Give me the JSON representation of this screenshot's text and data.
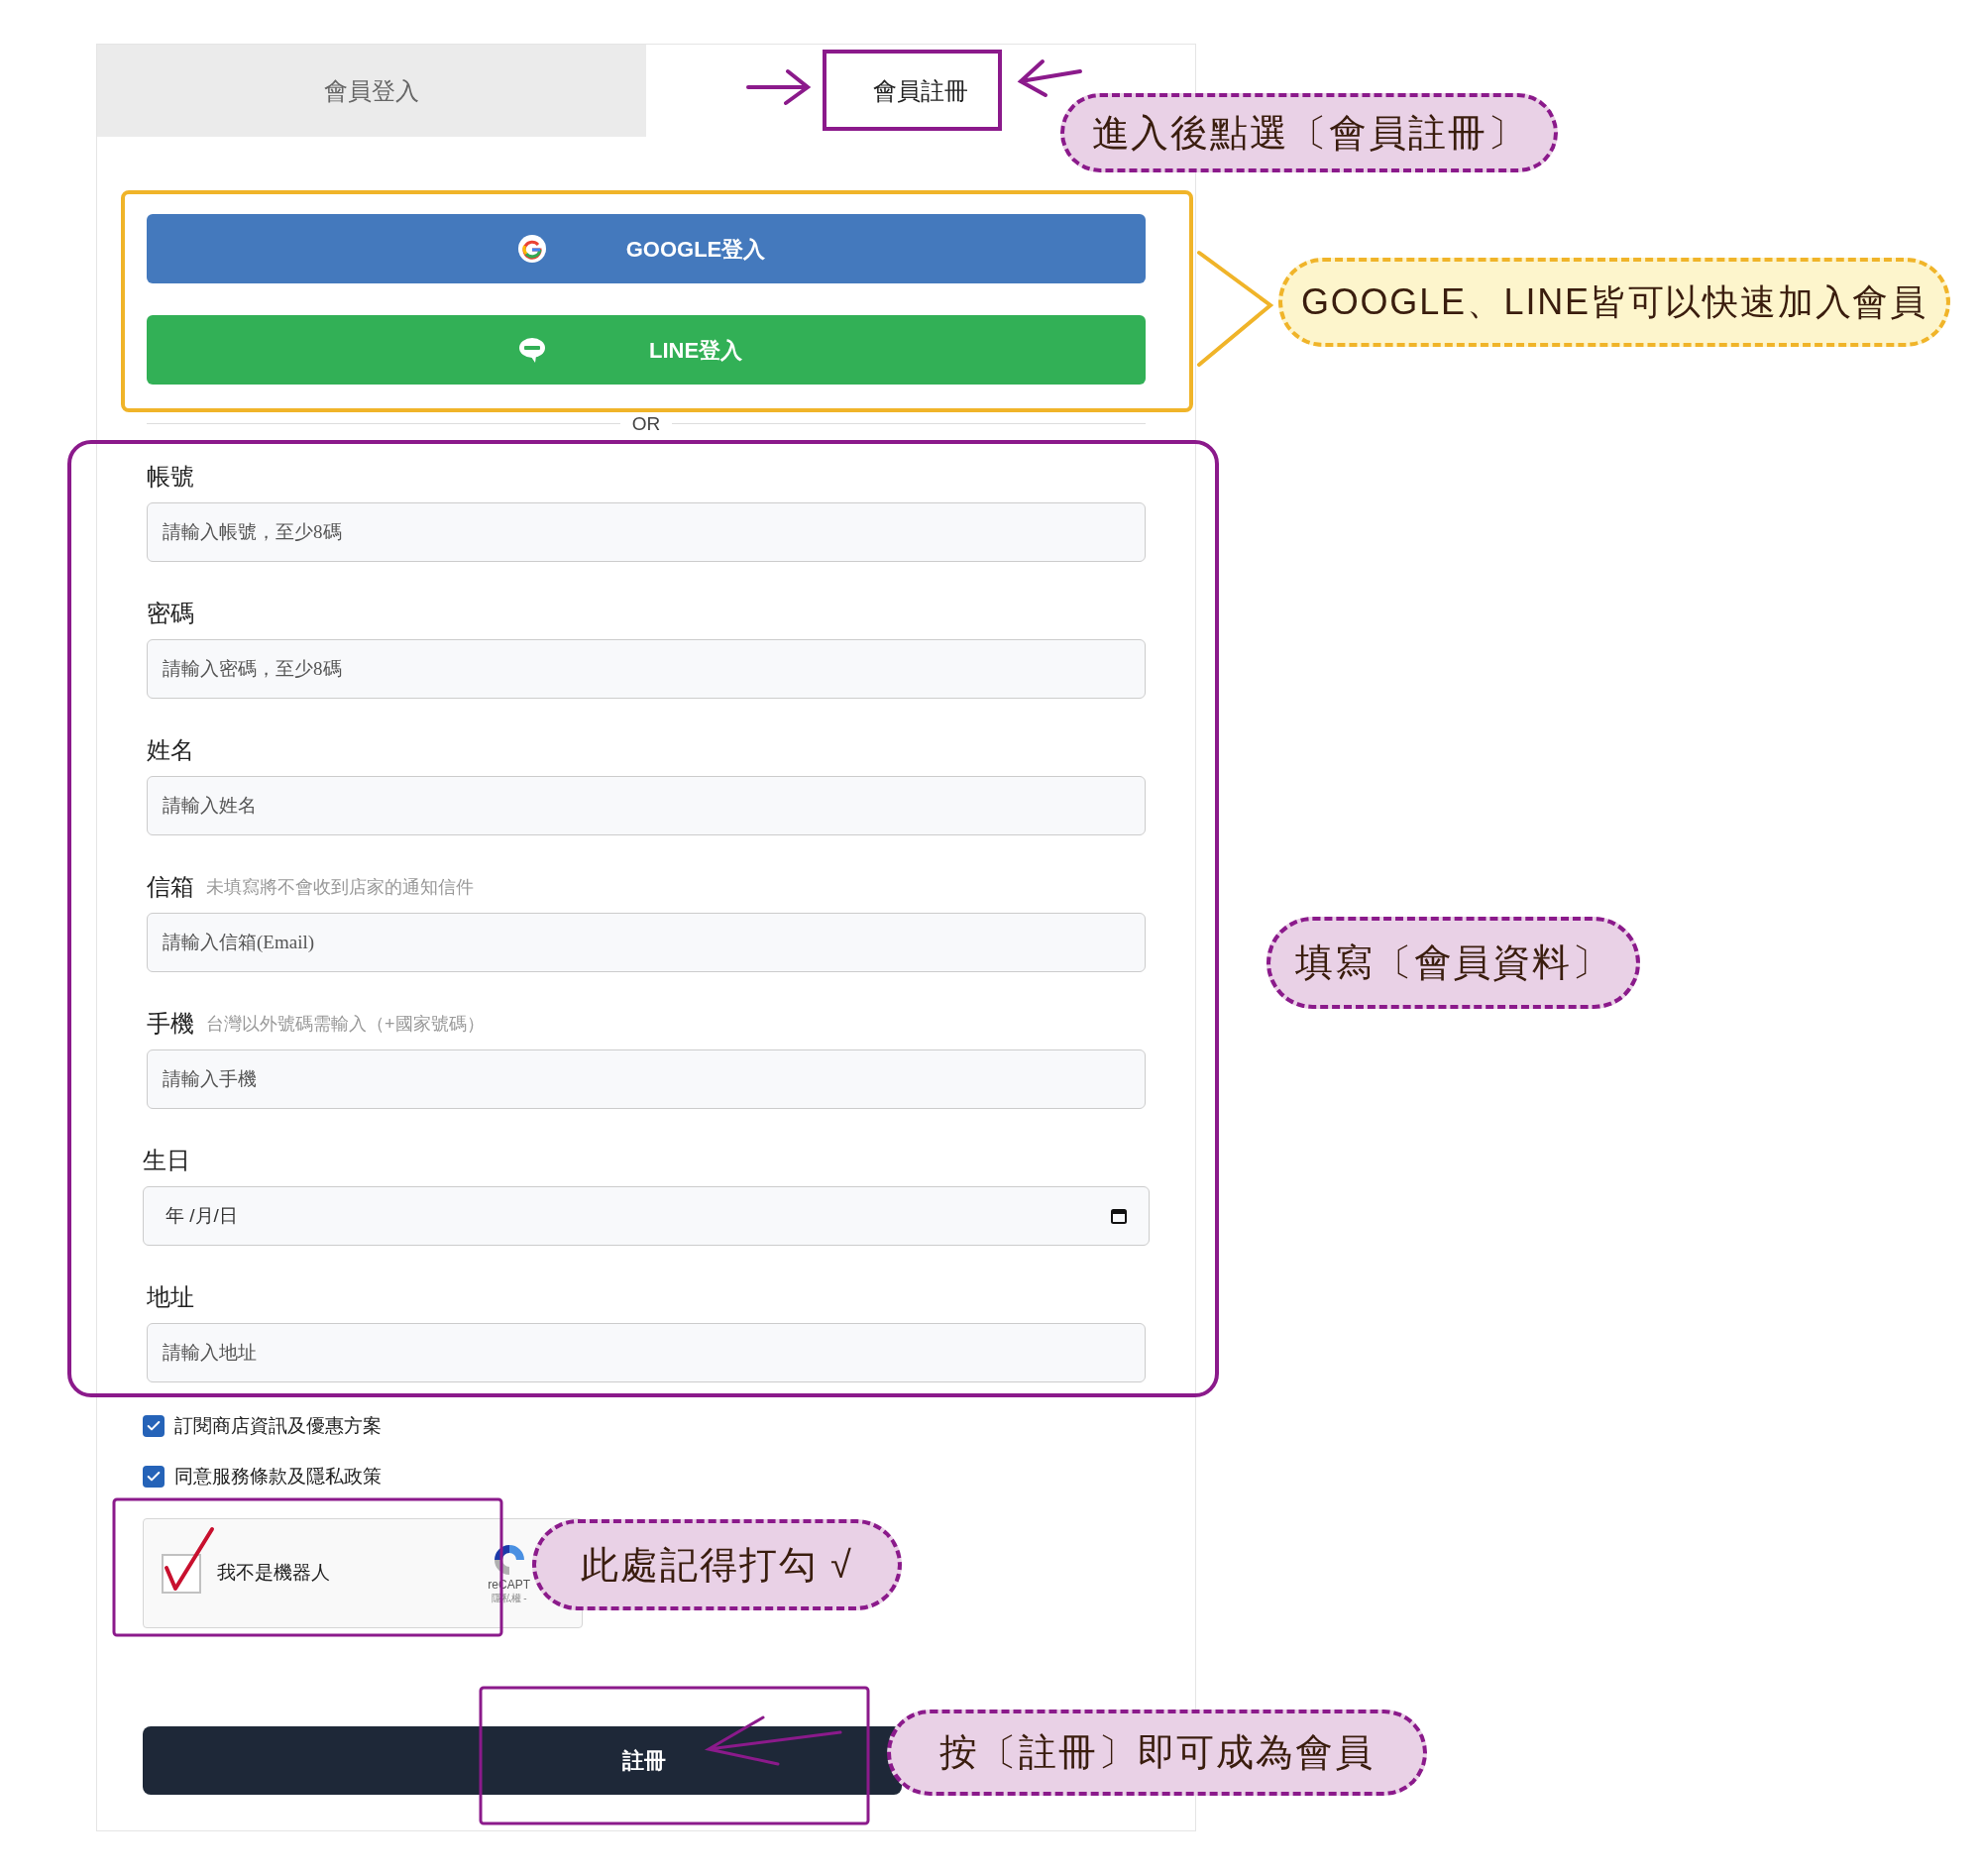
{
  "tabs": [
    {
      "label": "會員登入",
      "selected": false
    },
    {
      "label": "會員註冊",
      "selected": true
    }
  ],
  "social_buttons": [
    {
      "kind": "google",
      "label": "GOOGLE登入"
    },
    {
      "kind": "line",
      "label": "LINE登入"
    }
  ],
  "divider": "OR",
  "fields": [
    {
      "kind": "text",
      "label": "帳號",
      "placeholder": "請輸入帳號，至少8碼"
    },
    {
      "kind": "text",
      "label": "密碼",
      "placeholder": "請輸入密碼，至少8碼"
    },
    {
      "kind": "text",
      "label": "姓名",
      "placeholder": "請輸入姓名"
    },
    {
      "kind": "text",
      "label": "信箱",
      "hint": "未填寫將不會收到店家的通知信件",
      "placeholder": "請輸入信箱(Email)"
    },
    {
      "kind": "text",
      "label": "手機",
      "hint": "台灣以外號碼需輸入（+國家號碼）",
      "placeholder": "請輸入手機"
    },
    {
      "kind": "date",
      "label": "生日",
      "placeholder": "年 /月/日"
    },
    {
      "kind": "text",
      "label": "地址",
      "placeholder": "請輸入地址"
    }
  ],
  "checkboxes": [
    {
      "label": "訂閱商店資訊及優惠方案",
      "checked": true
    },
    {
      "label": "同意服務條款及隱私政策",
      "checked": true
    }
  ],
  "recaptcha": {
    "label": "我不是機器人",
    "checked": true,
    "brand": "reCAPT",
    "links": "隱私權 -"
  },
  "submit_button": "註冊",
  "annotations": [
    "進入後點選〔會員註冊〕",
    "GOOGLE、LINE皆可以快速加入會員",
    "填寫〔會員資料〕",
    "此處記得打勾 √",
    "按〔註冊〕即可成為會員"
  ]
}
